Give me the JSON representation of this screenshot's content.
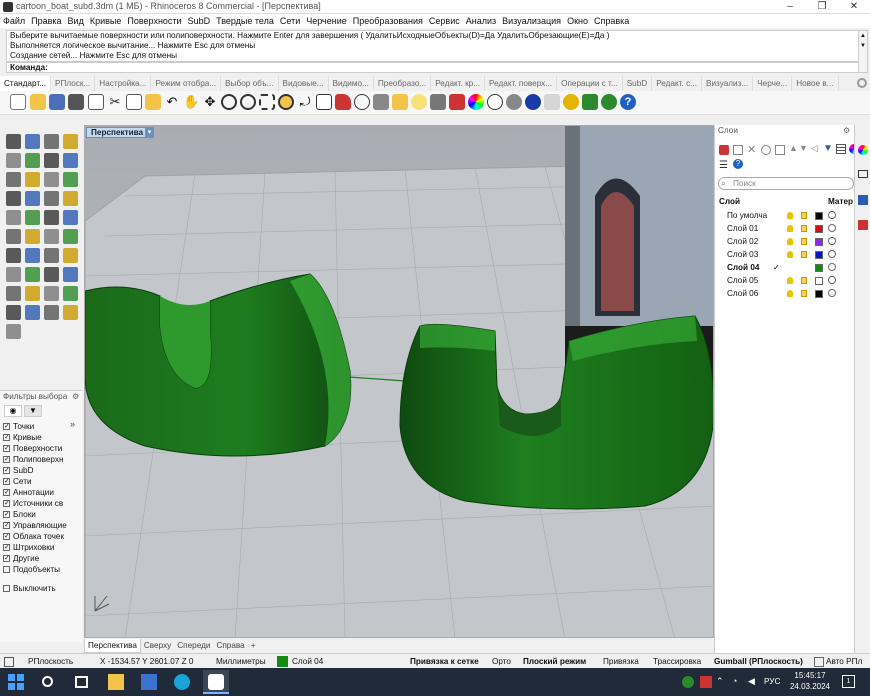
{
  "window": {
    "title": "cartoon_boat_subd.3dm (1 МБ) - Rhinoceros 8 Commercial - [Перспектива]",
    "controls": [
      "–",
      "❐",
      "✕"
    ]
  },
  "menu": [
    "Файл",
    "Правка",
    "Вид",
    "Кривые",
    "Поверхности",
    "SubD",
    "Твердые тела",
    "Сети",
    "Черчение",
    "Преобразования",
    "Сервис",
    "Анализ",
    "Визуализация",
    "Окно",
    "Справка"
  ],
  "command_history": [
    "Выберите вычитаемые поверхности или полиповерхности. Нажмите Enter для завершения ( УдалитьИсходныеОбъекты(D)=Да  УдалитьОбрезающие(E)=Да )",
    "Выполняется логическое вычитание... Нажмите Esc для отмены",
    "Создание сетей... Нажмите Esc для отмены"
  ],
  "command_prompt": "Команда:",
  "toolbar_tabs": [
    "Стандарт...",
    "РПлоск...",
    "Настройка...",
    "Режим отобра...",
    "Выбор объ...",
    "Видовые...",
    "Видимо...",
    "Преобразо...",
    "Редакт. кр...",
    "Редакт. поверх...",
    "Операции с т...",
    "SubD",
    "Редакт. с...",
    "Визуализ...",
    "Черче...",
    "Новое в..."
  ],
  "viewport": {
    "label": "Перспектива",
    "dropdown_icon": "▾"
  },
  "viewport_tabs": [
    "Перспектива",
    "Сверху",
    "Спереди",
    "Справа",
    "+"
  ],
  "filters": {
    "title": "Фильтры выбора",
    "items": [
      {
        "label": "Точки",
        "checked": true
      },
      {
        "label": "Кривые",
        "checked": true
      },
      {
        "label": "Поверхности",
        "checked": true
      },
      {
        "label": "Полиповерхн",
        "checked": true
      },
      {
        "label": "SubD",
        "checked": true
      },
      {
        "label": "Сети",
        "checked": true
      },
      {
        "label": "Аннотации",
        "checked": true
      },
      {
        "label": "Источники св",
        "checked": true
      },
      {
        "label": "Блоки",
        "checked": true
      },
      {
        "label": "Управляющие",
        "checked": true
      },
      {
        "label": "Облака точек",
        "checked": true
      },
      {
        "label": "Штриховки",
        "checked": true
      },
      {
        "label": "Другие",
        "checked": true
      },
      {
        "label": "Подобъекты",
        "checked": false
      }
    ],
    "disable_label": "Выключить",
    "more": "»"
  },
  "layers": {
    "title": "Слои",
    "search_placeholder": "Поиск",
    "col_layer": "Слой",
    "col_material": "Матер",
    "rows": [
      {
        "name": "По умолча",
        "color": "#000000",
        "current": false
      },
      {
        "name": "Слой 01",
        "color": "#d01010",
        "current": false
      },
      {
        "name": "Слой 02",
        "color": "#8a2be2",
        "current": false
      },
      {
        "name": "Слой 03",
        "color": "#1010d0",
        "current": false
      },
      {
        "name": "Слой 04",
        "color": "#138a13",
        "current": true,
        "check": "✓"
      },
      {
        "name": "Слой 05",
        "color": "#ffffff",
        "current": false
      },
      {
        "name": "Слой 06",
        "color": "#000000",
        "current": false
      }
    ]
  },
  "statusbar": {
    "cplane": "РПлоскость",
    "coords": "X -1534.57 Y 2601.07 Z 0",
    "units": "Миллиметры",
    "layer": "Слой 04",
    "layer_color": "#138a13",
    "grid_snap": "Привязка к сетке",
    "ortho": "Орто",
    "planar": "Плоский режим",
    "osnap": "Привязка",
    "smarttrack": "Трассировка",
    "gumball": "Gumball (РПлоскость)",
    "autocplane": "Авто РПл"
  },
  "taskbar": {
    "lang": "РУС",
    "time": "15:45:17",
    "date": "24.03.2024",
    "notif": "1"
  },
  "colors": {
    "accent": "#6d8fbd",
    "object_green": "#1d7a1d",
    "taskbar": "#202a38"
  }
}
